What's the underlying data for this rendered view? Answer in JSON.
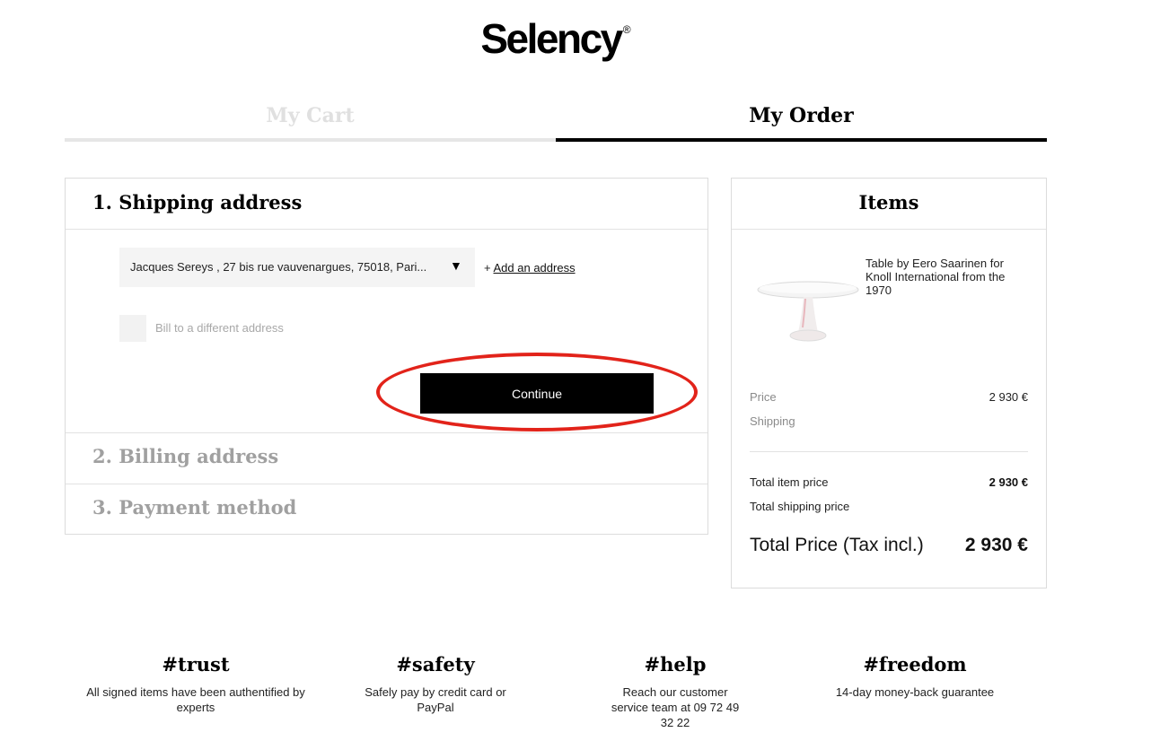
{
  "brand": {
    "logo_text": "Selency",
    "logo_mark": "®"
  },
  "tabs": [
    {
      "label": "My Cart",
      "active": false
    },
    {
      "label": "My Order",
      "active": true
    }
  ],
  "checkout": {
    "shipping": {
      "title": "1. Shipping address",
      "selected_address": "Jacques Sereys , 27 bis rue vauvenargues, 75018, Pari...",
      "add_prefix": "+",
      "add_link": "Add an address",
      "bill_checkbox_label": "Bill to a different address",
      "bill_checkbox_checked": false,
      "continue_label": "Continue"
    },
    "billing_title": "2. Billing address",
    "payment_title": "3. Payment method"
  },
  "items": {
    "title": "Items",
    "product": {
      "name": "Table by Eero Saarinen for Knoll International from the 1970",
      "image": "white-oval-tulip-table"
    },
    "price_label": "Price",
    "price_value": "2 930 €",
    "shipping_label": "Shipping",
    "total_item_label": "Total item price",
    "total_item_value": "2 930 €",
    "total_shipping_label": "Total shipping price",
    "total_price_label": "Total Price (Tax incl.)",
    "total_price_value": "2 930 €"
  },
  "features": [
    {
      "title": "#trust",
      "text": "All signed items have been authentified by experts"
    },
    {
      "title": "#safety",
      "text": "Safely pay by credit card or PayPal"
    },
    {
      "title": "#help",
      "text": "Reach our customer service team at 09 72 49 32 22"
    },
    {
      "title": "#freedom",
      "text": "14-day money-back guarantee"
    }
  ],
  "colors": {
    "accent": "#000000",
    "highlight": "#e2231a",
    "muted": "#a0a0a0"
  },
  "icons": {
    "address_dropdown": "caret-down-icon"
  }
}
